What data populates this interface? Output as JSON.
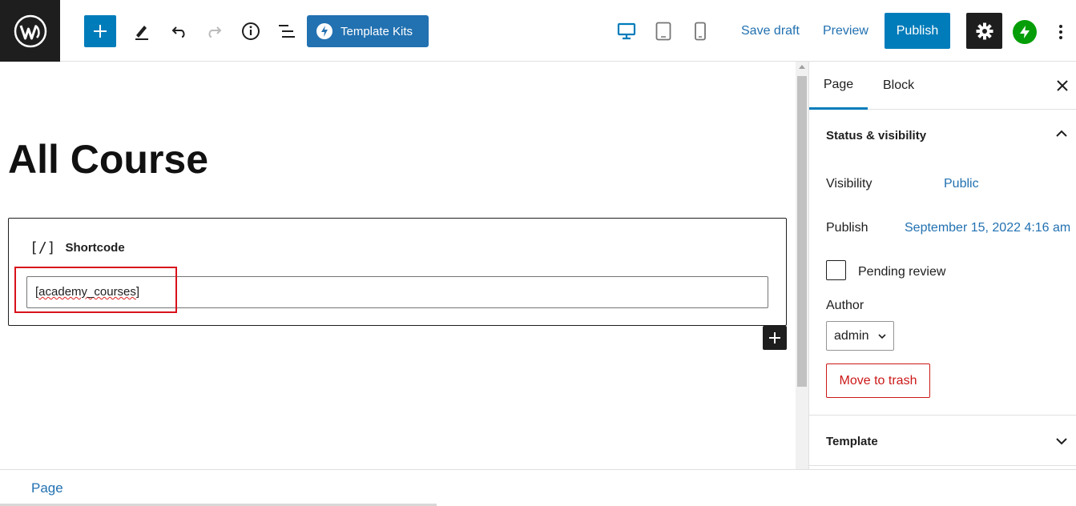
{
  "toolbar": {
    "logo_icon": "wordpress-logo",
    "add_icon": "plus-icon",
    "tools": [
      "pencil-icon",
      "undo-icon",
      "redo-icon",
      "info-icon",
      "list-view-icon"
    ],
    "template_kits_label": "Template Kits",
    "devices": [
      "desktop-icon",
      "tablet-icon",
      "mobile-icon"
    ],
    "save_draft_label": "Save draft",
    "preview_label": "Preview",
    "publish_label": "Publish",
    "settings_icon": "gear-icon",
    "jetpack_icon": "jetpack-icon",
    "more_icon": "more-vertical-icon",
    "accent_color": "#007cba"
  },
  "editor": {
    "title": "All Course",
    "block": {
      "icon": "[/]",
      "label": "Shortcode",
      "value_prefix": "[",
      "value_underlined": "academy_courses",
      "value_suffix": "]"
    }
  },
  "sidebar": {
    "tabs": [
      {
        "label": "Page",
        "active": true
      },
      {
        "label": "Block",
        "active": false
      }
    ],
    "status_panel": {
      "title": "Status & visibility",
      "visibility_label": "Visibility",
      "visibility_value": "Public",
      "publish_label": "Publish",
      "publish_value": "September 15, 2022 4:16 am",
      "pending_label": "Pending review",
      "pending_checked": false,
      "author_label": "Author",
      "author_value": "admin",
      "trash_label": "Move to trash"
    },
    "template_panel": {
      "title": "Template"
    }
  },
  "footer": {
    "breadcrumb": "Page"
  }
}
